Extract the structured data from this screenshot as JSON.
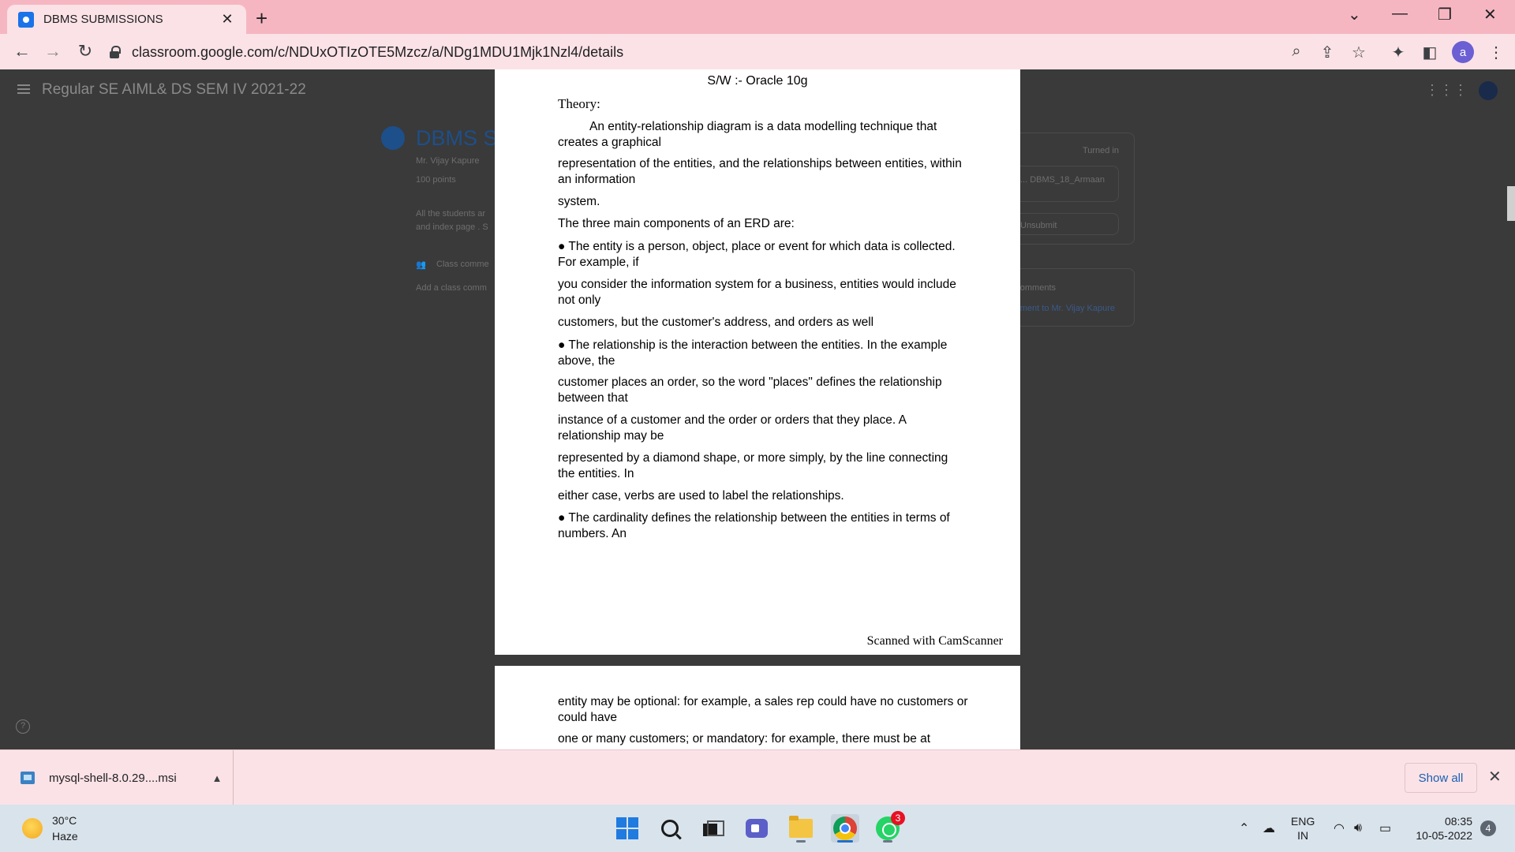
{
  "browser": {
    "tab_title": "DBMS SUBMISSIONS",
    "tab_close": "✕",
    "new_tab": "+",
    "url": "classroom.google.com/c/NDUxOTIzOTE5Mzcz/a/NDg1MDU1Mjk1Nzl4/details",
    "profile_initial": "a"
  },
  "classroom": {
    "course_title": "Regular SE AIML& DS SEM IV 2021-22",
    "assignment_title": "DBMS SUBMISSIONS",
    "teacher": "Mr. Vijay Kapure",
    "points": "100 points",
    "description_line1": "All the students ar",
    "description_line2": "and index page . S",
    "class_comments": "Class comme",
    "add_class_comment": "Add a class comm",
    "turned_in": "Turned in",
    "attachment": "DBMS_18_Armaan ...",
    "unsubmit": "Unsubmit",
    "private_comments": "Private comments",
    "private_comment_to": "Add comment to Mr. Vijay Kapure",
    "help": "?"
  },
  "document": {
    "page1_lines": [
      "S/W :- Oracle 10g",
      "Theory:",
      "An entity-relationship diagram is a data modelling technique that creates a graphical",
      "representation of the entities, and the relationships between entities, within an information",
      "system.",
      "The three main components of an ERD are:",
      "● The entity is a person, object, place or event for which data is collected. For example, if",
      "you consider the information system for a business, entities would include not only",
      "customers, but the customer's address, and orders as well",
      "● The relationship is the interaction between the entities. In the example above, the",
      "customer places an order, so the word \"places\" defines the relationship between that",
      "instance of a customer and the order or orders that they place. A relationship may be",
      "represented by a diamond shape, or more simply, by the line connecting the entities. In",
      "either case, verbs are used to label the relationships.",
      "● The cardinality defines the relationship between the entities in terms of numbers. An"
    ],
    "watermark": "Scanned with CamScanner",
    "page2_lines": [
      "entity may be optional: for example, a sales rep could have no customers or could have",
      "one or many customers; or mandatory: for example, there must be at"
    ]
  },
  "downloads": {
    "file_name": "mysql-shell-8.0.29....msi",
    "show_all": "Show all",
    "close": "✕"
  },
  "taskbar": {
    "temperature": "30°C",
    "weather": "Haze",
    "whatsapp_badge": "3",
    "lang_line1": "ENG",
    "lang_line2": "IN",
    "time": "08:35",
    "date": "10-05-2022",
    "notifications": "4"
  }
}
